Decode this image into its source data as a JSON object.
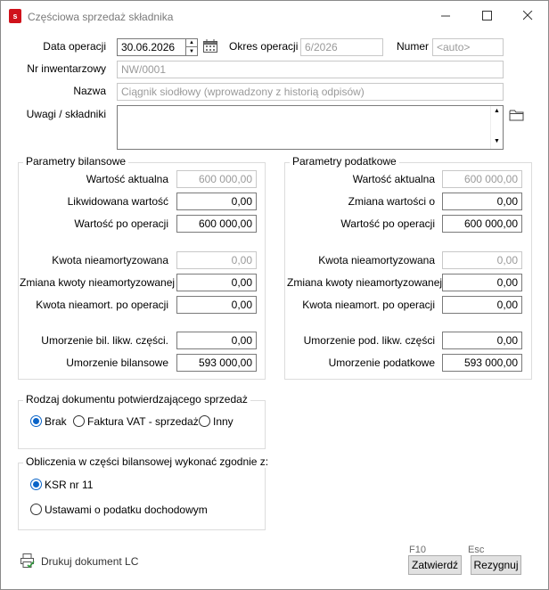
{
  "window": {
    "title": "Częściowa sprzedaż składnika"
  },
  "form": {
    "data_operacji_label": "Data operacji",
    "data_operacji_value": "30.06.2026",
    "okres_label": "Okres operacji",
    "okres_value": "6/2026",
    "numer_label": "Numer",
    "numer_placeholder": "<auto>",
    "nr_inw_label": "Nr inwentarzowy",
    "nr_inw_value": "NW/0001",
    "nazwa_label": "Nazwa",
    "nazwa_value": "Ciągnik siodłowy (wprowadzony z historią odpisów)",
    "uwagi_label": "Uwagi / składniki",
    "uwagi_value": ""
  },
  "bilansowe": {
    "title": "Parametry bilansowe",
    "rows": [
      {
        "label": "Wartość aktualna",
        "value": "600 000,00",
        "disabled": true
      },
      {
        "label": "Likwidowana wartość",
        "value": "0,00",
        "disabled": false
      },
      {
        "label": "Wartość po operacji",
        "value": "600 000,00",
        "disabled": false
      },
      {
        "label": "Kwota nieamortyzowana",
        "value": "0,00",
        "disabled": true
      },
      {
        "label": "Zmiana kwoty nieamortyzowanej",
        "value": "0,00",
        "disabled": false
      },
      {
        "label": "Kwota nieamort. po operacji",
        "value": "0,00",
        "disabled": false
      },
      {
        "label": "Umorzenie bil. likw. części.",
        "value": "0,00",
        "disabled": false
      },
      {
        "label": "Umorzenie bilansowe",
        "value": "593 000,00",
        "disabled": false
      }
    ]
  },
  "podatkowe": {
    "title": "Parametry podatkowe",
    "rows": [
      {
        "label": "Wartość aktualna",
        "value": "600 000,00",
        "disabled": true
      },
      {
        "label": "Zmiana wartości o",
        "value": "0,00",
        "disabled": false
      },
      {
        "label": "Wartość po operacji",
        "value": "600 000,00",
        "disabled": false
      },
      {
        "label": "Kwota nieamortyzowana",
        "value": "0,00",
        "disabled": true
      },
      {
        "label": "Zmiana kwoty nieamortyzowanej",
        "value": "0,00",
        "disabled": false
      },
      {
        "label": "Kwota nieamort. po operacji",
        "value": "0,00",
        "disabled": false
      },
      {
        "label": "Umorzenie pod. likw. części",
        "value": "0,00",
        "disabled": false
      },
      {
        "label": "Umorzenie podatkowe",
        "value": "593 000,00",
        "disabled": false
      }
    ]
  },
  "dokument": {
    "title": "Rodzaj dokumentu potwierdzającego sprzedaż",
    "options": [
      {
        "label": "Brak",
        "selected": true
      },
      {
        "label": "Faktura VAT - sprzedaż",
        "selected": false
      },
      {
        "label": "Inny",
        "selected": false
      }
    ]
  },
  "obliczenia": {
    "title": "Obliczenia w części bilansowej wykonać zgodnie z:",
    "options": [
      {
        "label": "KSR nr 11",
        "selected": true
      },
      {
        "label": "Ustawami o podatku dochodowym",
        "selected": false
      }
    ]
  },
  "footer": {
    "print_label": "Drukuj dokument LC",
    "confirm_hint": "F10",
    "confirm_label": "Zatwierdź",
    "cancel_hint": "Esc",
    "cancel_label": "Rezygnuj"
  },
  "colors": {
    "accent": "#0a64c8",
    "brand": "#d0121b"
  }
}
